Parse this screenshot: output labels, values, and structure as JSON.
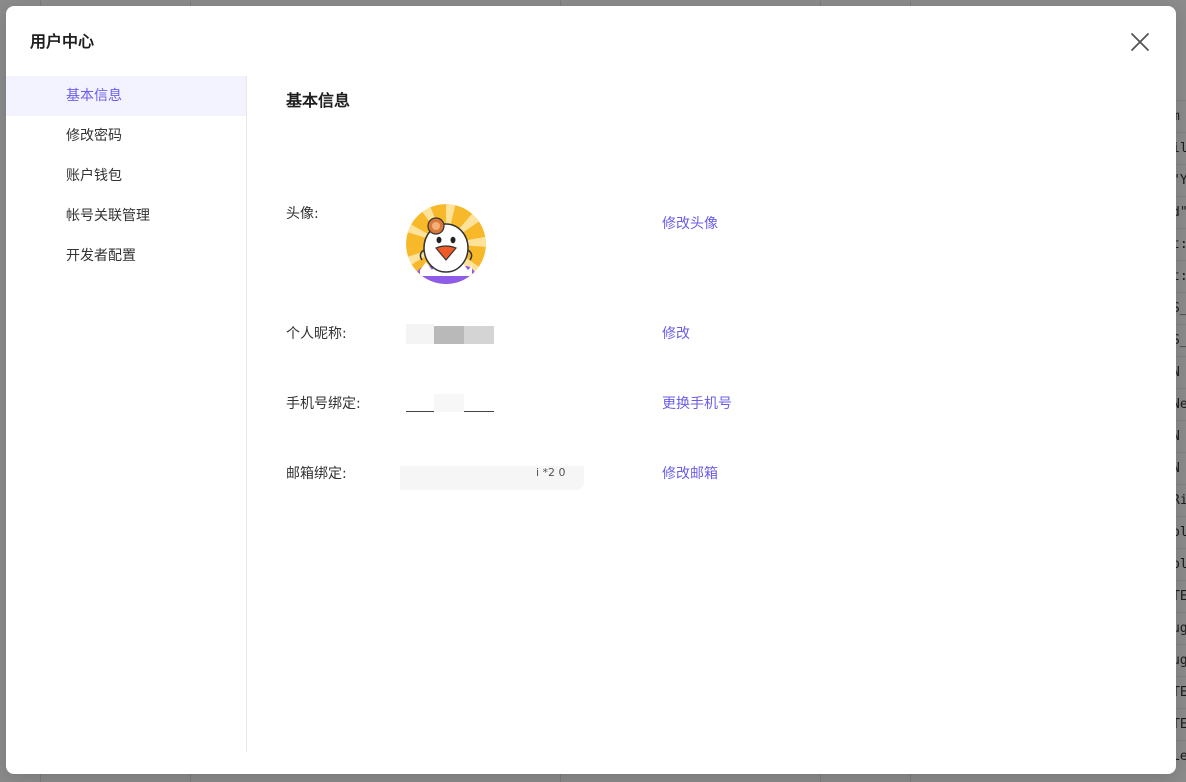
{
  "background": {
    "right_column_fragments": [
      "m",
      "ild",
      "\"Y",
      "d\",",
      "t:\"",
      "t:\"",
      "S_",
      "S_",
      "N",
      "Ne",
      "N",
      "N",
      "Ri",
      "pl",
      "pl",
      "TE",
      "ug",
      "ug",
      "TE",
      "TE",
      "Le"
    ]
  },
  "modal": {
    "title": "用户中心",
    "close_icon": "close-icon"
  },
  "side_nav": {
    "items": [
      {
        "label": "基本信息",
        "active": true
      },
      {
        "label": "修改密码",
        "active": false
      },
      {
        "label": "账户钱包",
        "active": false
      },
      {
        "label": "帐号关联管理",
        "active": false
      },
      {
        "label": "开发者配置",
        "active": false
      }
    ]
  },
  "content": {
    "title": "基本信息",
    "fields": {
      "avatar": {
        "label": "头像:",
        "action": "修改头像"
      },
      "nickname": {
        "label": "个人昵称:",
        "action": "修改"
      },
      "phone": {
        "label": "手机号绑定:",
        "action": "更换手机号"
      },
      "email": {
        "label": "邮箱绑定:",
        "action": "修改邮箱",
        "visible_fragment": "i *2 0"
      }
    }
  },
  "colors": {
    "accent": "#6b5de8",
    "active_nav_bg": "#f3f2ff",
    "text": "#333333",
    "title": "#1f1f1f"
  }
}
